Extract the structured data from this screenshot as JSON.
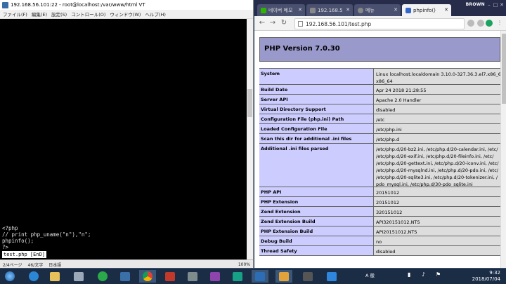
{
  "terminal": {
    "title": "192.168.56.101:22 - root@localhost:/var/www/html VT",
    "menu": [
      "ファイル(F)",
      "編集(E)",
      "設定(S)",
      "コントロール(O)",
      "ウィンドウ(W)",
      "ヘルプ(H)"
    ],
    "code_lines": [
      "<?php",
      "// print php_uname(\"n\"),\"n\";",
      "phpinfo();",
      "?>"
    ],
    "vim_status": "test.php [EnD]",
    "status": {
      "pos": "2/4ページ",
      "col": "46/文字",
      "zoom": "100%",
      "lang": "日本語"
    }
  },
  "browser": {
    "profile": "BROWN",
    "tabs": [
      {
        "label": "네이버 메모",
        "icon_color": "#2db400"
      },
      {
        "label": "192.168.5",
        "icon_color": "#888888"
      },
      {
        "label": "메뉴",
        "icon_color": "#888888"
      },
      {
        "label": "phpinfo()",
        "icon_color": "#3366cc"
      }
    ],
    "url": "192.168.56.101/test.php",
    "php_version": "PHP Version 7.0.30",
    "rows": [
      {
        "key": "System",
        "value": [
          "Linux localhost.localdomain 3.10.0-327.36.3.el7.x86_64",
          "x86_64"
        ]
      },
      {
        "key": "Build Date",
        "value": [
          "Apr 24 2018 21:28:55"
        ]
      },
      {
        "key": "Server API",
        "value": [
          "Apache 2.0 Handler"
        ]
      },
      {
        "key": "Virtual Directory Support",
        "value": [
          "disabled"
        ]
      },
      {
        "key": "Configuration File (php.ini) Path",
        "value": [
          "/etc"
        ]
      },
      {
        "key": "Loaded Configuration File",
        "value": [
          "/etc/php.ini"
        ]
      },
      {
        "key": "Scan this dir for additional .ini files",
        "value": [
          "/etc/php.d"
        ]
      },
      {
        "key": "Additional .ini files parsed",
        "value": [
          "/etc/php.d/20-bz2.ini, /etc/php.d/20-calendar.ini, /etc/",
          "/etc/php.d/20-exif.ini, /etc/php.d/20-fileinfo.ini, /etc/",
          "/etc/php.d/20-gettext.ini, /etc/php.d/20-iconv.ini, /etc/",
          "/etc/php.d/20-mysqlnd.ini, /etc/php.d/20-pdo.ini, /etc/",
          "/etc/php.d/20-sqlite3.ini, /etc/php.d/20-tokenizer.ini, /",
          "pdo_mysql.ini, /etc/php.d/30-pdo_sqlite.ini"
        ]
      },
      {
        "key": "PHP API",
        "value": [
          "20151012"
        ]
      },
      {
        "key": "PHP Extension",
        "value": [
          "20151012"
        ]
      },
      {
        "key": "Zend Extension",
        "value": [
          "320151012"
        ]
      },
      {
        "key": "Zend Extension Build",
        "value": [
          "API320151012,NTS"
        ]
      },
      {
        "key": "PHP Extension Build",
        "value": [
          "API20151012,NTS"
        ]
      },
      {
        "key": "Debug Build",
        "value": [
          "no"
        ]
      },
      {
        "key": "Thread Safety",
        "value": [
          "disabled"
        ]
      }
    ]
  },
  "taskbar": {
    "clock_time": "9:32",
    "clock_date": "2018/07/04",
    "tray_text": "A 般"
  }
}
